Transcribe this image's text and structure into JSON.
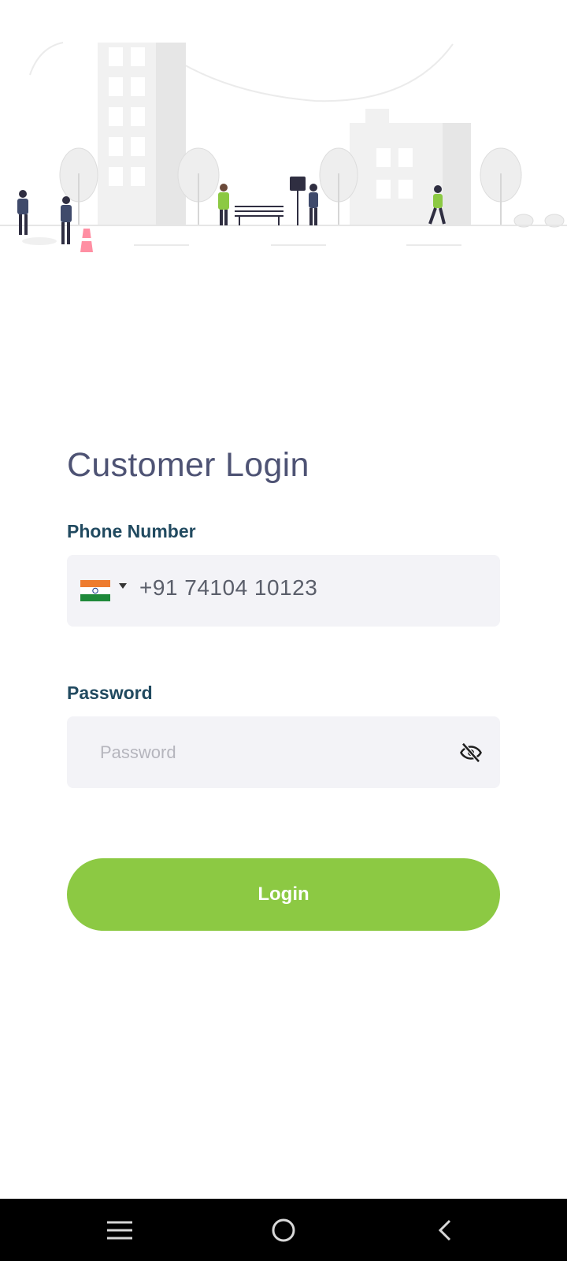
{
  "illustration": {
    "description_icon": "city-street-illustration-icon"
  },
  "login": {
    "title": "Customer Login",
    "phone_label": "Phone Number",
    "phone_value": "+91 74104 10123",
    "country_flag_icon": "india-flag-icon",
    "password_label": "Password",
    "password_placeholder": "Password",
    "password_value": "",
    "visibility_icon": "eye-off-icon",
    "button_label": "Login"
  },
  "colors": {
    "accent": "#8cc943",
    "title": "#4e5374",
    "label": "#214a60",
    "input_bg": "#f3f3f7"
  },
  "nav": {
    "recents_icon": "menu-lines-icon",
    "home_icon": "circle-home-icon",
    "back_icon": "chevron-left-icon"
  }
}
